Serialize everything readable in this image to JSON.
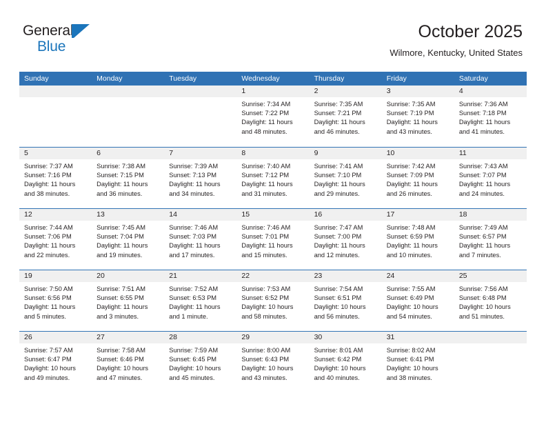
{
  "brand": {
    "name_top": "General",
    "name_bottom": "Blue",
    "mark": "triangle-logo"
  },
  "header": {
    "title": "October 2025",
    "subtitle": "Wilmore, Kentucky, United States"
  },
  "colors": {
    "header_blue": "#3072b4",
    "brand_blue": "#1b75bb",
    "day_band": "#f0f0f0",
    "text": "#231f20"
  },
  "weekdays": [
    "Sunday",
    "Monday",
    "Tuesday",
    "Wednesday",
    "Thursday",
    "Friday",
    "Saturday"
  ],
  "weeks": [
    [
      {
        "day": "",
        "lines": []
      },
      {
        "day": "",
        "lines": []
      },
      {
        "day": "",
        "lines": []
      },
      {
        "day": "1",
        "lines": [
          "Sunrise: 7:34 AM",
          "Sunset: 7:22 PM",
          "Daylight: 11 hours",
          "and 48 minutes."
        ]
      },
      {
        "day": "2",
        "lines": [
          "Sunrise: 7:35 AM",
          "Sunset: 7:21 PM",
          "Daylight: 11 hours",
          "and 46 minutes."
        ]
      },
      {
        "day": "3",
        "lines": [
          "Sunrise: 7:35 AM",
          "Sunset: 7:19 PM",
          "Daylight: 11 hours",
          "and 43 minutes."
        ]
      },
      {
        "day": "4",
        "lines": [
          "Sunrise: 7:36 AM",
          "Sunset: 7:18 PM",
          "Daylight: 11 hours",
          "and 41 minutes."
        ]
      }
    ],
    [
      {
        "day": "5",
        "lines": [
          "Sunrise: 7:37 AM",
          "Sunset: 7:16 PM",
          "Daylight: 11 hours",
          "and 38 minutes."
        ]
      },
      {
        "day": "6",
        "lines": [
          "Sunrise: 7:38 AM",
          "Sunset: 7:15 PM",
          "Daylight: 11 hours",
          "and 36 minutes."
        ]
      },
      {
        "day": "7",
        "lines": [
          "Sunrise: 7:39 AM",
          "Sunset: 7:13 PM",
          "Daylight: 11 hours",
          "and 34 minutes."
        ]
      },
      {
        "day": "8",
        "lines": [
          "Sunrise: 7:40 AM",
          "Sunset: 7:12 PM",
          "Daylight: 11 hours",
          "and 31 minutes."
        ]
      },
      {
        "day": "9",
        "lines": [
          "Sunrise: 7:41 AM",
          "Sunset: 7:10 PM",
          "Daylight: 11 hours",
          "and 29 minutes."
        ]
      },
      {
        "day": "10",
        "lines": [
          "Sunrise: 7:42 AM",
          "Sunset: 7:09 PM",
          "Daylight: 11 hours",
          "and 26 minutes."
        ]
      },
      {
        "day": "11",
        "lines": [
          "Sunrise: 7:43 AM",
          "Sunset: 7:07 PM",
          "Daylight: 11 hours",
          "and 24 minutes."
        ]
      }
    ],
    [
      {
        "day": "12",
        "lines": [
          "Sunrise: 7:44 AM",
          "Sunset: 7:06 PM",
          "Daylight: 11 hours",
          "and 22 minutes."
        ]
      },
      {
        "day": "13",
        "lines": [
          "Sunrise: 7:45 AM",
          "Sunset: 7:04 PM",
          "Daylight: 11 hours",
          "and 19 minutes."
        ]
      },
      {
        "day": "14",
        "lines": [
          "Sunrise: 7:46 AM",
          "Sunset: 7:03 PM",
          "Daylight: 11 hours",
          "and 17 minutes."
        ]
      },
      {
        "day": "15",
        "lines": [
          "Sunrise: 7:46 AM",
          "Sunset: 7:01 PM",
          "Daylight: 11 hours",
          "and 15 minutes."
        ]
      },
      {
        "day": "16",
        "lines": [
          "Sunrise: 7:47 AM",
          "Sunset: 7:00 PM",
          "Daylight: 11 hours",
          "and 12 minutes."
        ]
      },
      {
        "day": "17",
        "lines": [
          "Sunrise: 7:48 AM",
          "Sunset: 6:59 PM",
          "Daylight: 11 hours",
          "and 10 minutes."
        ]
      },
      {
        "day": "18",
        "lines": [
          "Sunrise: 7:49 AM",
          "Sunset: 6:57 PM",
          "Daylight: 11 hours",
          "and 7 minutes."
        ]
      }
    ],
    [
      {
        "day": "19",
        "lines": [
          "Sunrise: 7:50 AM",
          "Sunset: 6:56 PM",
          "Daylight: 11 hours",
          "and 5 minutes."
        ]
      },
      {
        "day": "20",
        "lines": [
          "Sunrise: 7:51 AM",
          "Sunset: 6:55 PM",
          "Daylight: 11 hours",
          "and 3 minutes."
        ]
      },
      {
        "day": "21",
        "lines": [
          "Sunrise: 7:52 AM",
          "Sunset: 6:53 PM",
          "Daylight: 11 hours",
          "and 1 minute."
        ]
      },
      {
        "day": "22",
        "lines": [
          "Sunrise: 7:53 AM",
          "Sunset: 6:52 PM",
          "Daylight: 10 hours",
          "and 58 minutes."
        ]
      },
      {
        "day": "23",
        "lines": [
          "Sunrise: 7:54 AM",
          "Sunset: 6:51 PM",
          "Daylight: 10 hours",
          "and 56 minutes."
        ]
      },
      {
        "day": "24",
        "lines": [
          "Sunrise: 7:55 AM",
          "Sunset: 6:49 PM",
          "Daylight: 10 hours",
          "and 54 minutes."
        ]
      },
      {
        "day": "25",
        "lines": [
          "Sunrise: 7:56 AM",
          "Sunset: 6:48 PM",
          "Daylight: 10 hours",
          "and 51 minutes."
        ]
      }
    ],
    [
      {
        "day": "26",
        "lines": [
          "Sunrise: 7:57 AM",
          "Sunset: 6:47 PM",
          "Daylight: 10 hours",
          "and 49 minutes."
        ]
      },
      {
        "day": "27",
        "lines": [
          "Sunrise: 7:58 AM",
          "Sunset: 6:46 PM",
          "Daylight: 10 hours",
          "and 47 minutes."
        ]
      },
      {
        "day": "28",
        "lines": [
          "Sunrise: 7:59 AM",
          "Sunset: 6:45 PM",
          "Daylight: 10 hours",
          "and 45 minutes."
        ]
      },
      {
        "day": "29",
        "lines": [
          "Sunrise: 8:00 AM",
          "Sunset: 6:43 PM",
          "Daylight: 10 hours",
          "and 43 minutes."
        ]
      },
      {
        "day": "30",
        "lines": [
          "Sunrise: 8:01 AM",
          "Sunset: 6:42 PM",
          "Daylight: 10 hours",
          "and 40 minutes."
        ]
      },
      {
        "day": "31",
        "lines": [
          "Sunrise: 8:02 AM",
          "Sunset: 6:41 PM",
          "Daylight: 10 hours",
          "and 38 minutes."
        ]
      },
      {
        "day": "",
        "lines": []
      }
    ]
  ]
}
